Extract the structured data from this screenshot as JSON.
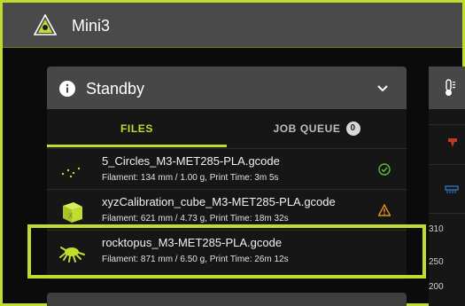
{
  "app": {
    "title": "Mini3"
  },
  "panel": {
    "title": "Standby",
    "tabs": [
      {
        "label": "FILES",
        "active": true
      },
      {
        "label": "JOB QUEUE",
        "badge": "0",
        "active": false
      }
    ],
    "files": [
      {
        "name": "5_Circles_M3-MET285-PLA.gcode",
        "meta": "Filament: 134 mm / 1.00 g, Print Time: 3m 5s",
        "status": "check-circle-icon"
      },
      {
        "name": "xyzCalibration_cube_M3-MET285-PLA.gcode",
        "meta": "Filament: 621 mm / 4.73 g, Print Time: 18m 32s",
        "status": "warning-icon"
      },
      {
        "name": "rocktopus_M3-MET285-PLA.gcode",
        "meta": "Filament: 871 mm / 6.50 g, Print Time: 26m 12s",
        "status": ""
      }
    ]
  },
  "right_panel": {
    "axis_ticks": [
      "310",
      "250",
      "200"
    ]
  },
  "colors": {
    "accent": "#bfdd2e",
    "header": "#4a4a4a",
    "warning": "#e09020",
    "ok": "#5dbb3a"
  }
}
